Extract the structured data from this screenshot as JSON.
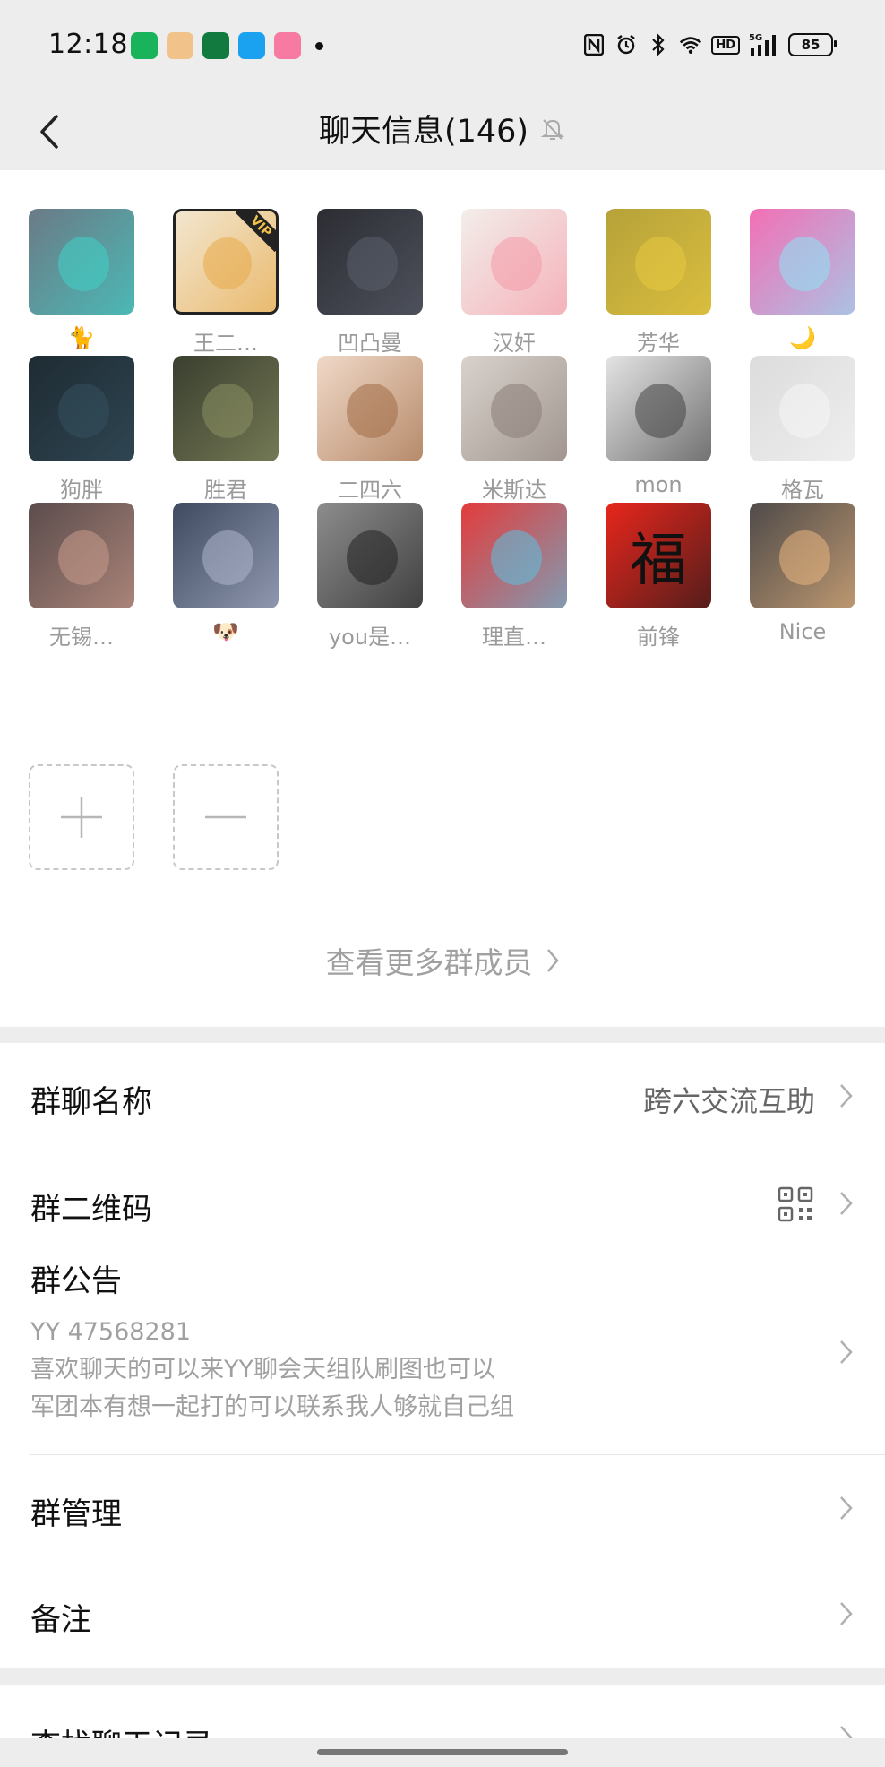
{
  "status": {
    "time": "12:18",
    "battery": "85",
    "hd": "HD",
    "net": "5G",
    "app_icons": [
      {
        "name": "store-app-icon",
        "color": "#19b35c"
      },
      {
        "name": "pet-app-icon",
        "color": "#f1c28a"
      },
      {
        "name": "oppo-app-icon",
        "color": "#127a3f"
      },
      {
        "name": "qq-app-icon",
        "color": "#1aa1f0"
      },
      {
        "name": "bilibili-app-icon",
        "color": "#f77aa3"
      }
    ]
  },
  "header": {
    "title": "聊天信息(146)"
  },
  "members": [
    {
      "name": "🐈",
      "bg": "#6b7a86",
      "accent": "#3fd1c7"
    },
    {
      "name": "王二…",
      "bg": "#f2e6cf",
      "accent": "#e7a949",
      "vip": "VIP"
    },
    {
      "name": "凹凸曼",
      "bg": "#2c2d33",
      "accent": "#5a5f6b"
    },
    {
      "name": "汉奸",
      "bg": "#f3eeea",
      "accent": "#f49aa8"
    },
    {
      "name": "芳华",
      "bg": "#b6a23a",
      "accent": "#e7c83f"
    },
    {
      "name": "🌙",
      "bg": "#f36fb5",
      "accent": "#8ee3f6"
    },
    {
      "name": "狗胖",
      "bg": "#1e2b33",
      "accent": "#35505e"
    },
    {
      "name": "胜君",
      "bg": "#3a3f2f",
      "accent": "#8a8f63"
    },
    {
      "name": "二四六",
      "bg": "#f0d9c8",
      "accent": "#a06b45"
    },
    {
      "name": "米斯达",
      "bg": "#d9d2cc",
      "accent": "#8a7e77"
    },
    {
      "name": "mon",
      "bg": "#e4e4e4",
      "accent": "#444"
    },
    {
      "name": "格瓦",
      "bg": "#dcdcdc",
      "accent": "#f5f5f5"
    },
    {
      "name": "无锡…",
      "bg": "#5b4c4c",
      "accent": "#c99a8a"
    },
    {
      "name": "🐶",
      "bg": "#3f4a61",
      "accent": "#aeb6cc"
    },
    {
      "name": "you是…",
      "bg": "#8d8d8d",
      "accent": "#222"
    },
    {
      "name": "理直…",
      "bg": "#e33b3b",
      "accent": "#5bc1e0"
    },
    {
      "name": "前锋",
      "bg": "#e8261c",
      "accent": "#1a1a1a",
      "glyph": "福"
    },
    {
      "name": "Nice",
      "bg": "#4f4a49",
      "accent": "#e9b780"
    }
  ],
  "actions": {
    "add_symbol": "+",
    "remove_symbol": "−"
  },
  "view_more": "查看更多群成员",
  "settings": {
    "group_name_label": "群聊名称",
    "group_name_value": "跨六交流互助",
    "qr_label": "群二维码",
    "notice_label": "群公告",
    "notice_lines": [
      "YY 47568281",
      "喜欢聊天的可以来YY聊会天组队刷图也可以",
      "军团本有想一起打的可以联系我人够就自己组"
    ],
    "manage_label": "群管理",
    "remark_label": "备注",
    "search_label": "查找聊天记录"
  }
}
